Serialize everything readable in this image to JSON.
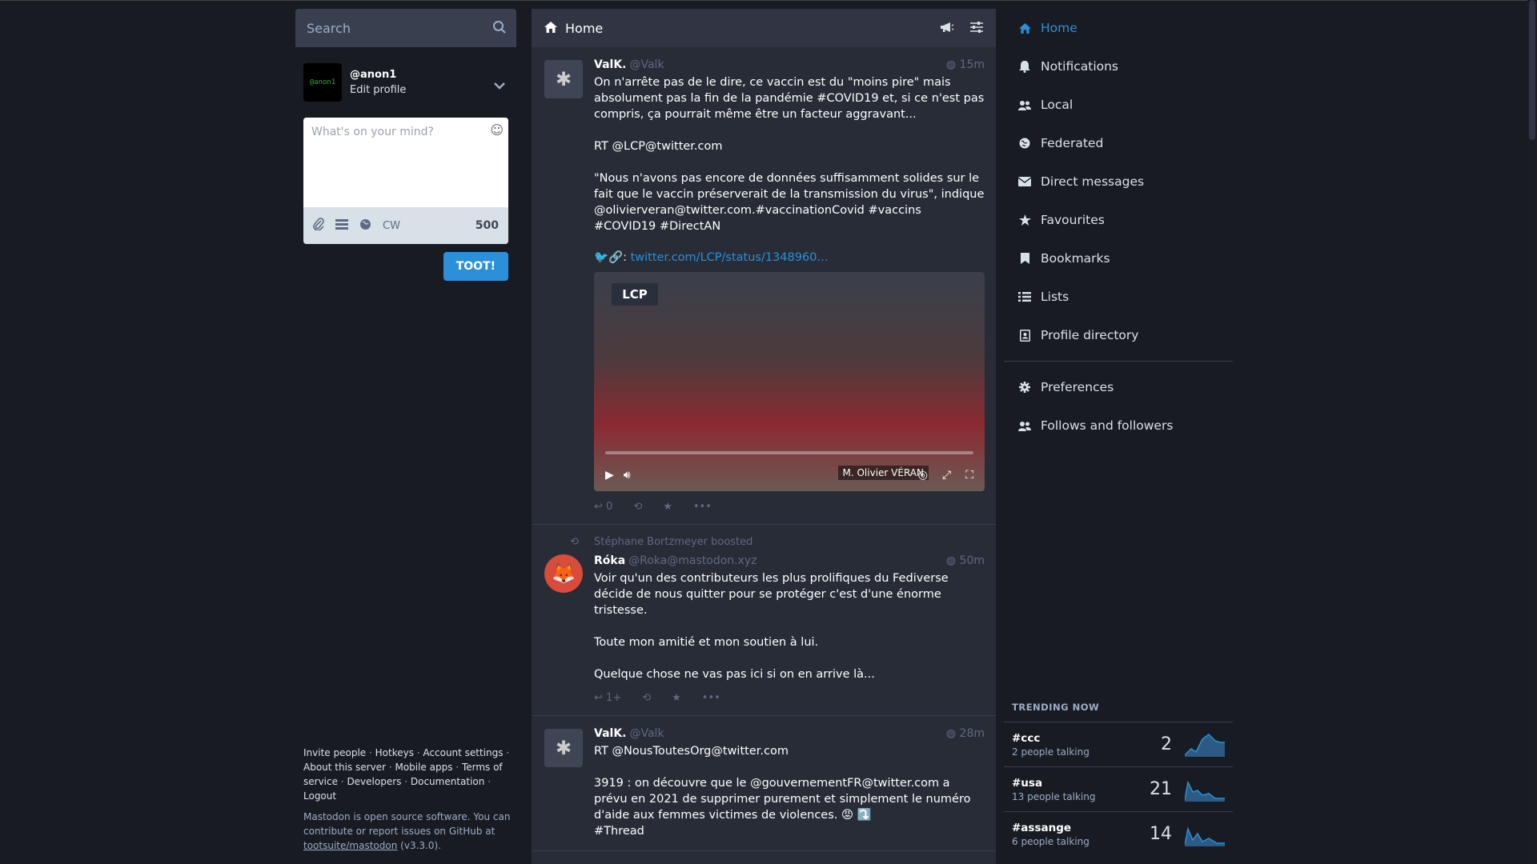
{
  "search": {
    "placeholder": "Search"
  },
  "account": {
    "avatar_text": "@anon1",
    "handle": "@anon1",
    "edit_label": "Edit profile"
  },
  "compose": {
    "placeholder": "What's on your mind?",
    "cw_label": "CW",
    "char_count": "500",
    "toot_label": "TOOT!"
  },
  "footer": {
    "links": [
      "Invite people",
      "Hotkeys",
      "Account settings",
      "About this server",
      "Mobile apps",
      "Terms of service",
      "Developers",
      "Documentation",
      "Logout"
    ],
    "note_pre": "Mastodon is open source software. You can contribute or report issues on GitHub at",
    "repo": "tootsuite/mastodon",
    "version": "(v3.3.0)."
  },
  "column": {
    "title": "Home"
  },
  "statuses": [
    {
      "name": "ValK.",
      "handle": "@Valk",
      "time": "15m",
      "body": "On n'arrête pas de le dire, ce vaccin est du \"moins pire\" mais absolument pas la fin de la pandémie #COVID19 et, si ce n'est pas compris, ça pourrait même être un facteur aggravant...\n\nRT @LCP@twitter.com\n\n\"Nous n'avons pas encore de données suffisamment solides sur le fait que le vaccin préserverait de la transmission du virus\", indique @olivierveran@twitter.com.#vaccinationCovid #vaccins #COVID19 #DirectAN",
      "link_prefix": "🐦🔗:",
      "link": "twitter.com/LCP/status/1348960…",
      "media_logo": "LCP",
      "media_caption": "M. Olivier VÉRAN",
      "replies": "0"
    },
    {
      "boosted_by": "Stéphane Bortzmeyer boosted",
      "name": "Róka",
      "handle": "@Roka@mastodon.xyz",
      "time": "50m",
      "body": "Voir qu'un des contributeurs les plus prolifiques du Fediverse décide de nous quitter pour se protéger c'est d'une énorme tristesse.\n\nToute mon amitié et mon soutien à lui.\n\nQuelque chose ne vas pas ici si on en arrive là...",
      "replies": "1+"
    },
    {
      "name": "ValK.",
      "handle": "@Valk",
      "time": "28m",
      "body": "RT @NousToutesOrg@twitter.com\n\n3919 : on découvre que le @gouvernementFR@twitter.com a prévu en 2021 de supprimer purement et simplement le numéro d'aide aux femmes victimes de violences. 😡 ⤵️\n#Thread"
    }
  ],
  "nav": {
    "items": [
      "Home",
      "Notifications",
      "Local",
      "Federated",
      "Direct messages",
      "Favourites",
      "Bookmarks",
      "Lists",
      "Profile directory"
    ],
    "settings": [
      "Preferences",
      "Follows and followers"
    ]
  },
  "trending": {
    "title": "TRENDING NOW",
    "items": [
      {
        "tag": "#ccc",
        "people": "2 people talking",
        "count": "2"
      },
      {
        "tag": "#usa",
        "people": "13 people talking",
        "count": "21"
      },
      {
        "tag": "#assange",
        "people": "6 people talking",
        "count": "14"
      }
    ]
  },
  "colors": {
    "accent": "#2b90d9",
    "background": "#191b22",
    "column": "#282c37"
  }
}
